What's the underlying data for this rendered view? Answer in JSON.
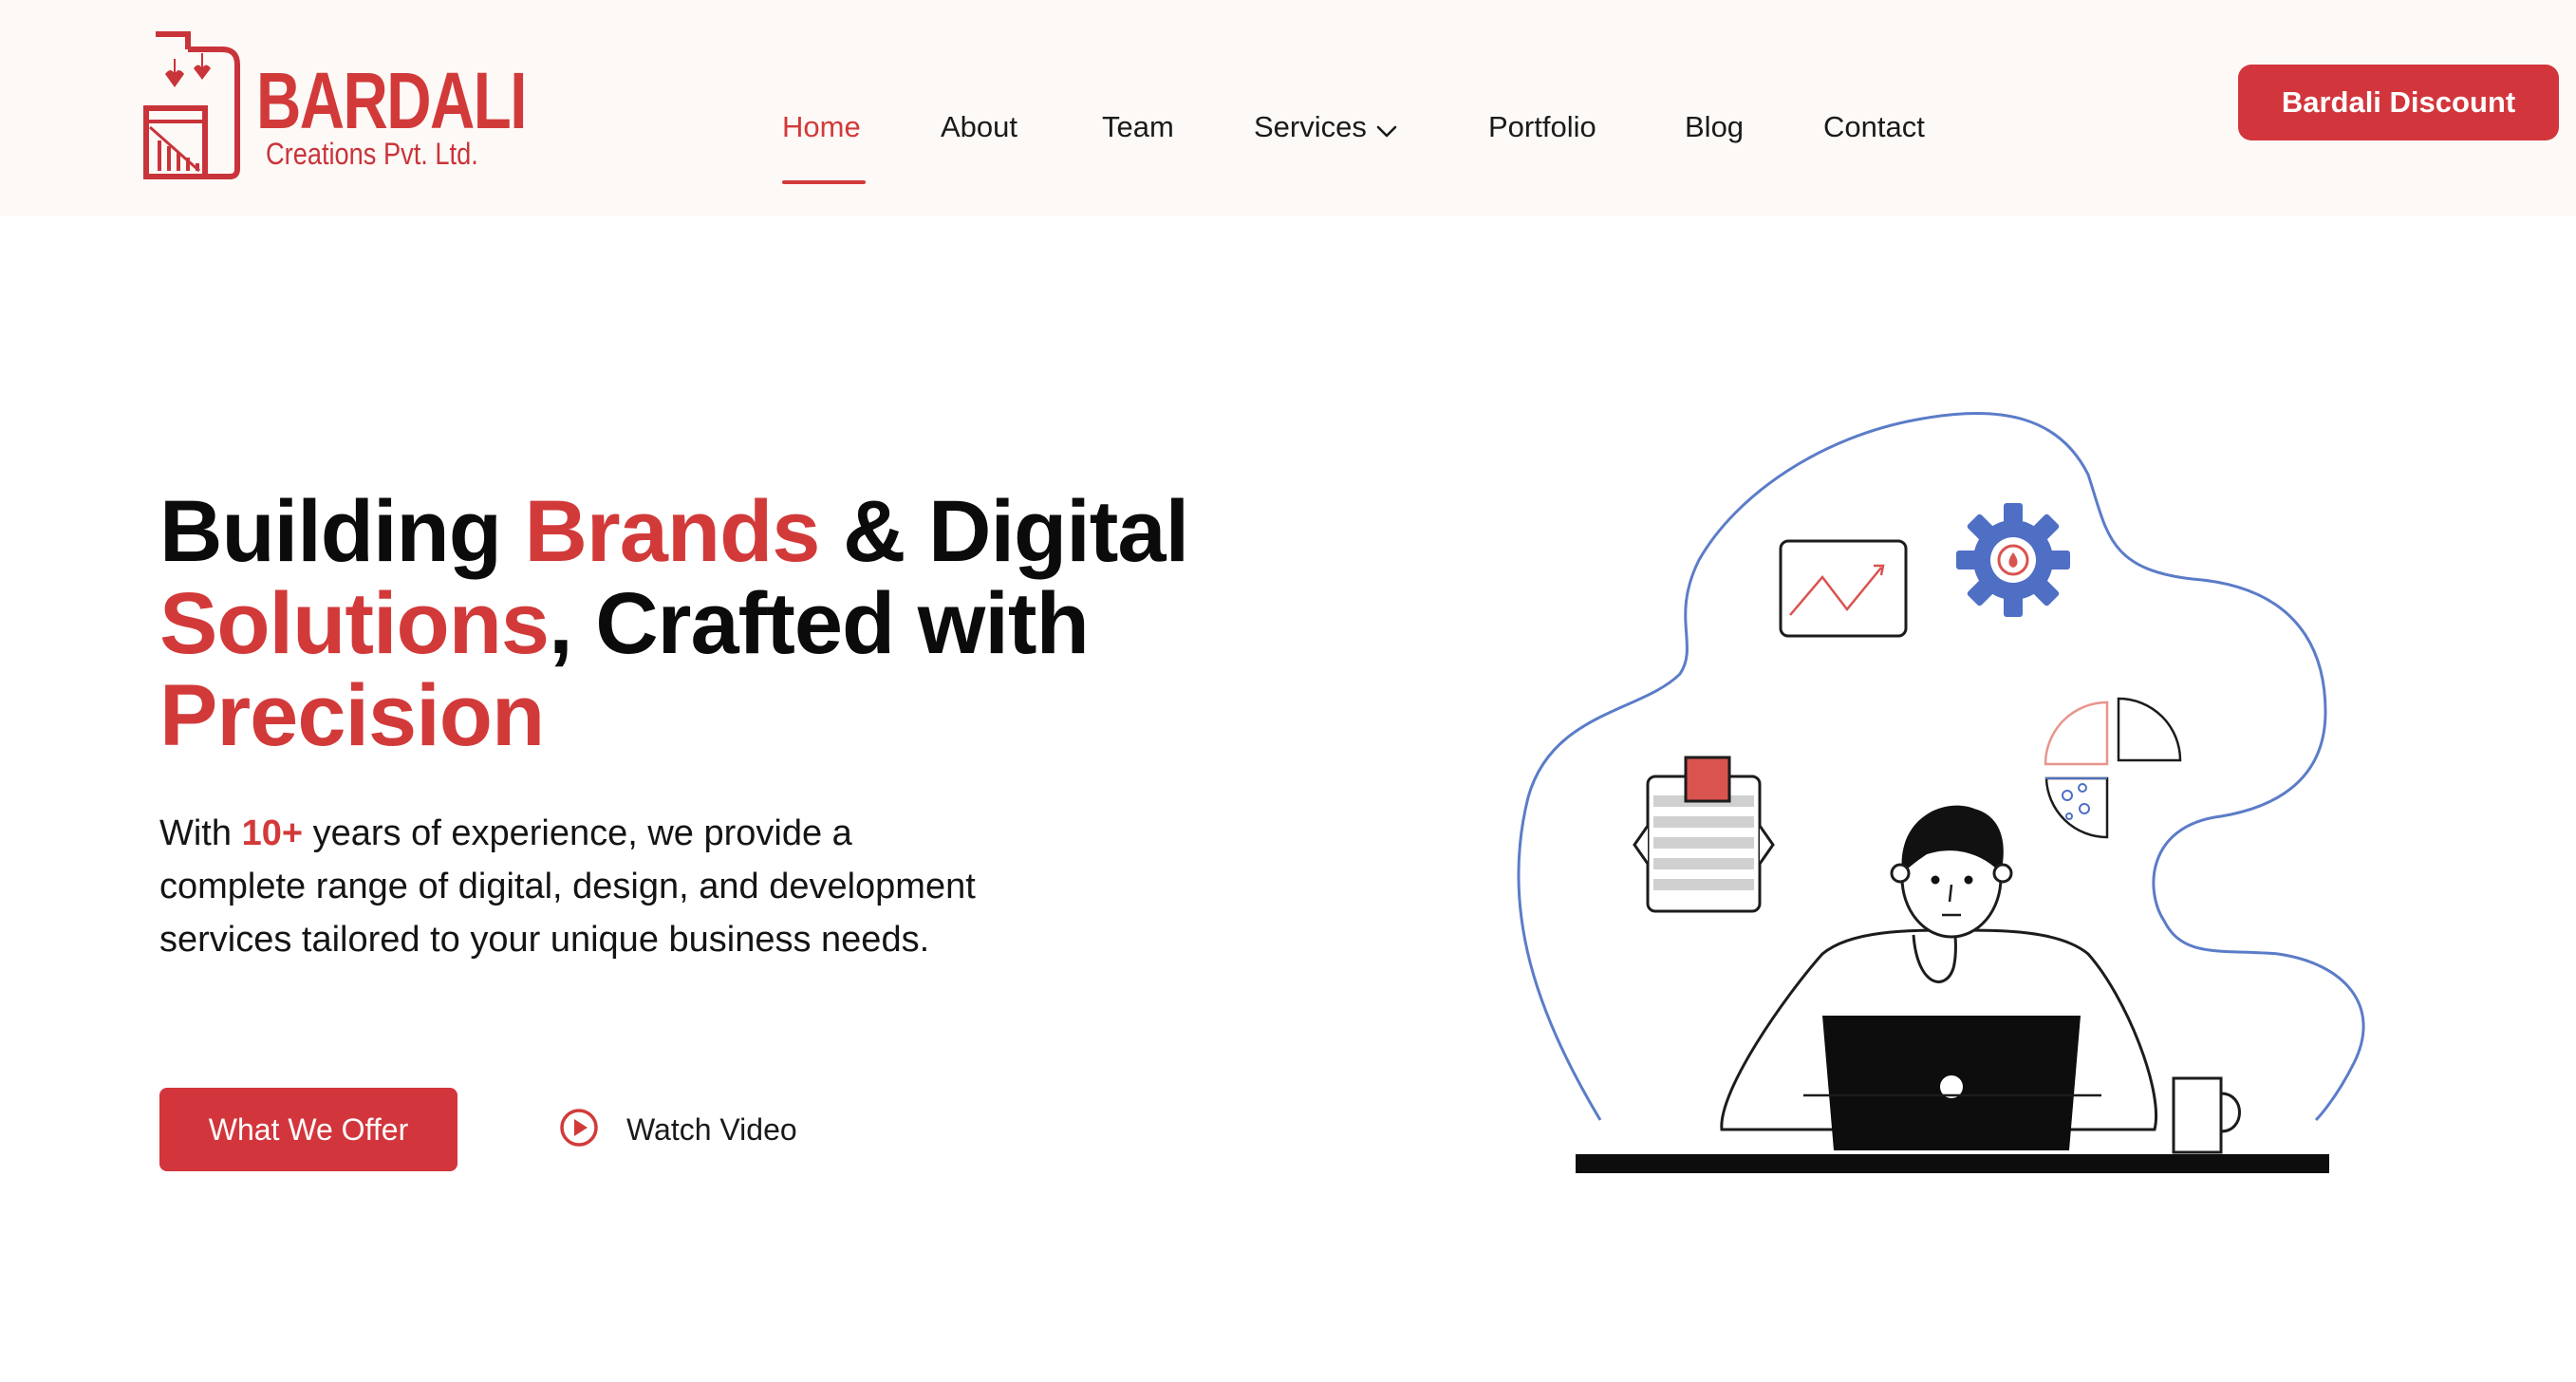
{
  "brand": {
    "name": "BARDALI",
    "subtitle": "Creations Pvt. Ltd.",
    "color": "#d23a3a"
  },
  "nav": {
    "items": [
      {
        "label": "Home",
        "active": true
      },
      {
        "label": "About",
        "active": false
      },
      {
        "label": "Team",
        "active": false
      },
      {
        "label": "Services",
        "active": false,
        "has_dropdown": true
      },
      {
        "label": "Portfolio",
        "active": false
      },
      {
        "label": "Blog",
        "active": false
      },
      {
        "label": "Contact",
        "active": false
      }
    ],
    "cta_label": "Bardali Discount"
  },
  "hero": {
    "title_parts": [
      "Building ",
      "Brands",
      " & Digital ",
      "Solutions",
      ", Crafted with ",
      "Precision"
    ],
    "text_before": "With ",
    "text_highlight": "10+",
    "text_after": " years of experience, we provide a complete range of digital, design, and development services tailored to your unique business needs.",
    "primary_button": "What We Offer",
    "secondary_button": "Watch Video"
  },
  "icons": [
    "chevron-down-icon",
    "play-circle-icon",
    "logo-icon"
  ],
  "colors": {
    "accent": "#d23a3a",
    "header_bg": "#fdf9f6",
    "illustration_line": "#5b7cc8",
    "gear": "#4f6fc4"
  }
}
